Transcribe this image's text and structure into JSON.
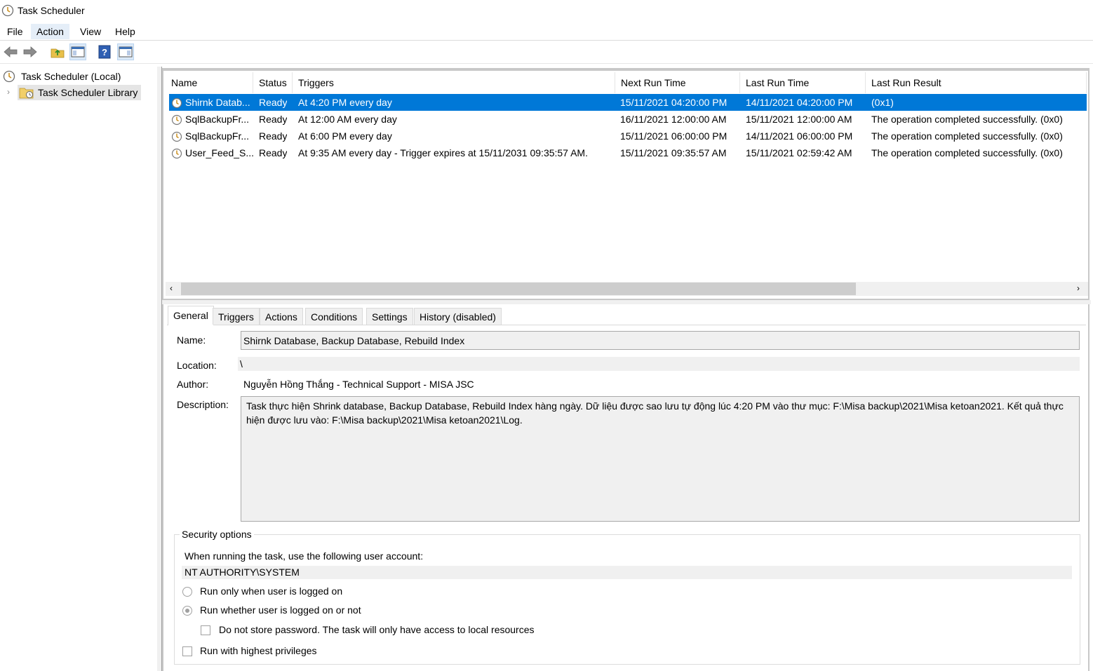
{
  "window": {
    "title": "Task Scheduler"
  },
  "menu": {
    "items": [
      "File",
      "Action",
      "View",
      "Help"
    ]
  },
  "toolbar": {
    "icons": [
      "back-arrow-icon",
      "forward-arrow-icon",
      "up-folder-icon",
      "show-hide-console-tree-icon",
      "help-icon",
      "show-hide-action-pane-icon"
    ]
  },
  "tree": {
    "root": "Task Scheduler (Local)",
    "library": "Task Scheduler Library"
  },
  "tasks": {
    "columns": [
      "Name",
      "Status",
      "Triggers",
      "Next Run Time",
      "Last Run Time",
      "Last Run Result"
    ],
    "rows": [
      [
        "Shirnk Datab...",
        "Ready",
        "At 4:20 PM every day",
        "15/11/2021 04:20:00 PM",
        "14/11/2021 04:20:00 PM",
        "(0x1)"
      ],
      [
        "SqlBackupFr...",
        "Ready",
        "At 12:00 AM every day",
        "16/11/2021 12:00:00 AM",
        "15/11/2021 12:00:00 AM",
        "The operation completed successfully. (0x0)"
      ],
      [
        "SqlBackupFr...",
        "Ready",
        "At 6:00 PM every day",
        "15/11/2021 06:00:00 PM",
        "14/11/2021 06:00:00 PM",
        "The operation completed successfully. (0x0)"
      ],
      [
        "User_Feed_S...",
        "Ready",
        "At 9:35 AM every day - Trigger expires at 15/11/2031 09:35:57 AM.",
        "15/11/2021 09:35:57 AM",
        "15/11/2021 02:59:42 AM",
        "The operation completed successfully. (0x0)"
      ]
    ]
  },
  "tabs": [
    "General",
    "Triggers",
    "Actions",
    "Conditions",
    "Settings",
    "History (disabled)"
  ],
  "general": {
    "name_label": "Name:",
    "name_value": "Shirnk Database, Backup Database, Rebuild Index",
    "location_label": "Location:",
    "location_value": "\\",
    "author_label": "Author:",
    "author_value": "Nguyễn Hồng Thắng - Technical Support - MISA JSC",
    "description_label": "Description:",
    "description_value": "Task thực hiện Shrink database, Backup Database, Rebuild Index hàng ngày. Dữ liệu được sao lưu tự động lúc 4:20 PM vào thư mục: F:\\Misa backup\\2021\\Misa ketoan2021. Kết quả thực hiện được lưu vào: F:\\Misa backup\\2021\\Misa ketoan2021\\Log."
  },
  "security": {
    "title": "Security options",
    "account_prompt": "When running the task, use the following user account:",
    "account": "NT AUTHORITY\\SYSTEM",
    "radio1": "Run only when user is logged on",
    "radio2": "Run whether user is logged on or not",
    "no_store_password": "Do not store password.  The task will only have access to local resources",
    "highest_privileges": "Run with highest privileges"
  },
  "colors": {
    "selection": "#0078d7"
  }
}
